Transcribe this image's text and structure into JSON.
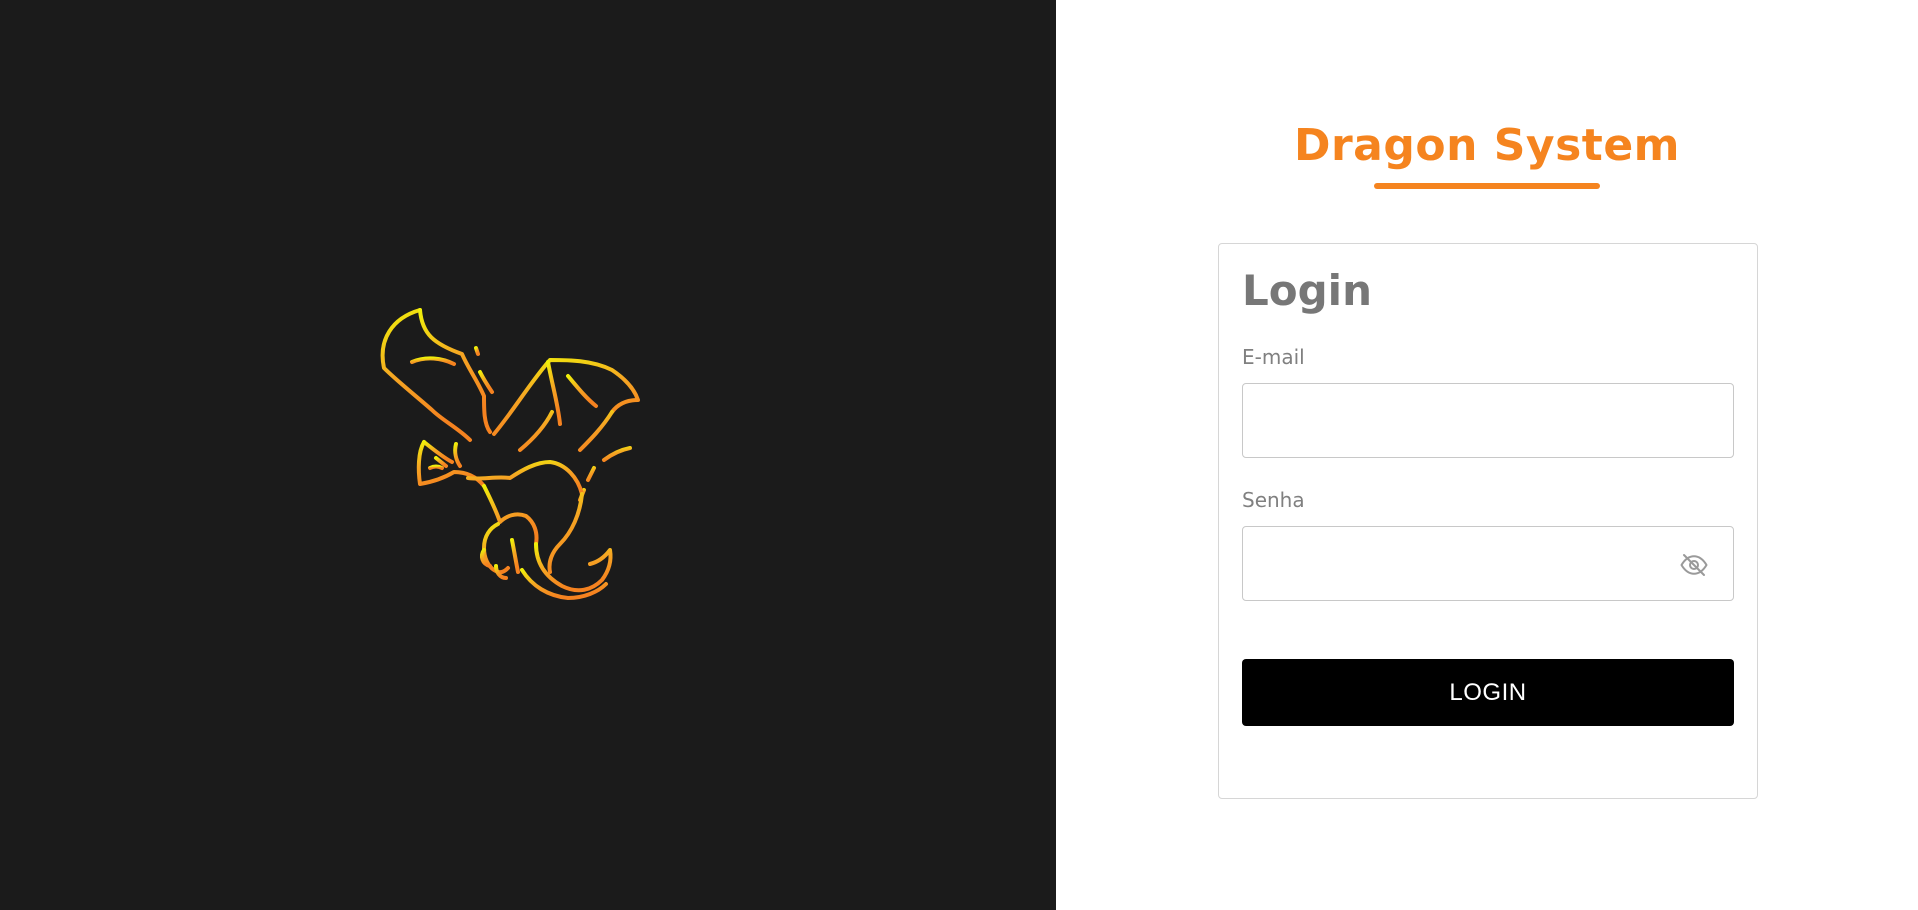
{
  "brand": {
    "title": "Dragon System",
    "accent_color": "#f5841f"
  },
  "login_form": {
    "heading": "Login",
    "email": {
      "label": "E-mail",
      "value": "",
      "placeholder": ""
    },
    "password": {
      "label": "Senha",
      "value": "",
      "placeholder": "",
      "toggle_icon": "eye-off-icon"
    },
    "submit_label": "LOGIN"
  },
  "left_panel": {
    "background_color": "#1b1b1b",
    "logo_icon": "dragon-icon",
    "logo_gradient": [
      "#f0f00a",
      "#f58220"
    ]
  }
}
